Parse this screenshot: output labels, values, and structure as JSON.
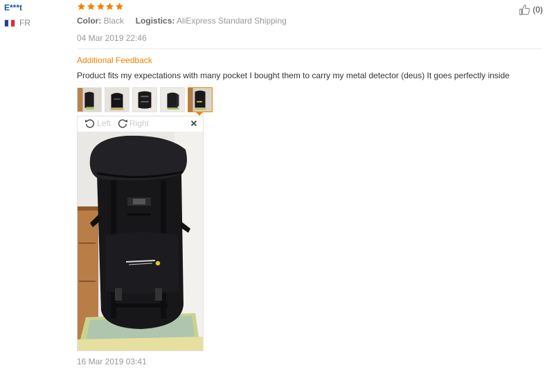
{
  "user": {
    "name": "E***t",
    "country": "FR",
    "flag_colors": [
      "#1f3f9c",
      "#ffffff",
      "#e0283a"
    ]
  },
  "review": {
    "rating": 5,
    "star_color": "#f08200",
    "color_label": "Color:",
    "color_value": "Black",
    "logistics_label": "Logistics:",
    "logistics_value": "AliExpress Standard Shipping",
    "date": "04 Mar 2019 22:46",
    "helpful_count": "(0)"
  },
  "additional": {
    "title": "Additional Feedback",
    "text": "Product fits my expectations with many pocket I bought them to carry my metal detector (deus) It goes perfectly inside",
    "date": "16 Mar 2019 03:41",
    "thumbnail_count": 5,
    "active_thumbnail": 5
  },
  "viewer": {
    "rotate_left_label": "Left",
    "rotate_right_label": "Right",
    "close_icon": "close-icon"
  },
  "colors": {
    "accent": "#f08200",
    "user_link": "#1a5aa8",
    "muted": "#999999"
  }
}
